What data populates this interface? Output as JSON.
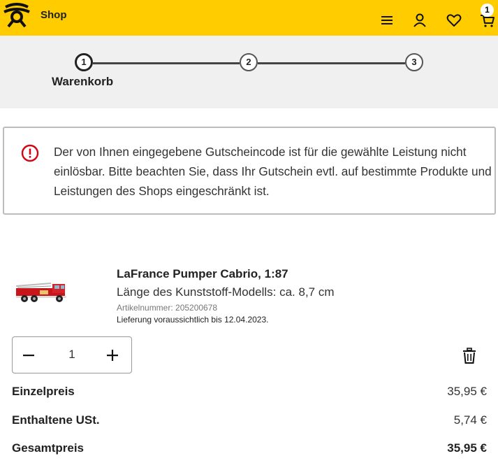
{
  "header": {
    "shop_label": "Shop",
    "cart_count": "1",
    "icons": [
      "menu-icon",
      "account-icon",
      "heart-icon",
      "cart-icon"
    ],
    "brand_color": "#ffcc00"
  },
  "stepper": {
    "steps": [
      "1",
      "2",
      "3"
    ],
    "active_step_label": "Warenkorb"
  },
  "alert": {
    "text": "Der von Ihnen eingegebene Gutscheincode ist für die gewählte Leistung nicht einlösbar. Bitte beachten Sie, dass Ihr Gutschein evtl. auf bestimmte Produkte und Leistungen des Shops eingeschränkt ist.",
    "icon": "error-icon",
    "icon_color": "#d40511"
  },
  "product": {
    "title": "LaFrance Pumper Cabrio, 1:87",
    "subtitle": "Länge des Kunststoff-Modells: ca. 8,7 cm",
    "article_number": "Artikelnummer: 205200678",
    "delivery": "Lieferung voraussichtlich bis 12.04.2023.",
    "quantity": "1"
  },
  "prices": {
    "unit_label": "Einzelpreis",
    "unit_value": "35,95 €",
    "vat_label": "Enthaltene USt.",
    "vat_value": "5,74 €",
    "total_label": "Gesamtpreis",
    "total_value": "35,95 €"
  }
}
